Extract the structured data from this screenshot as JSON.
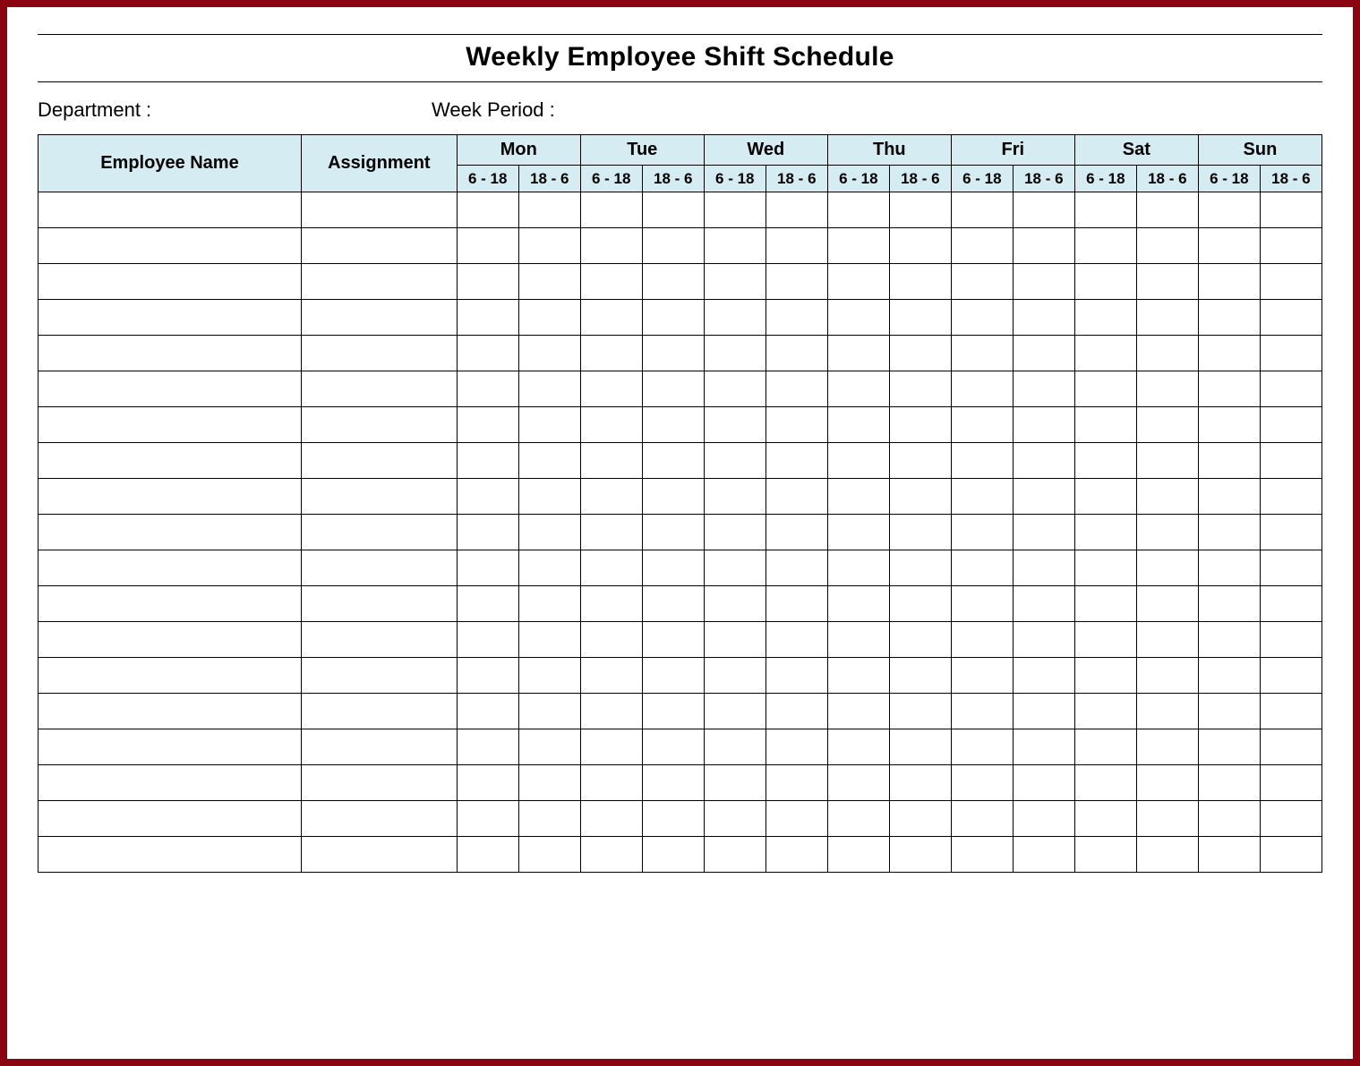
{
  "title": "Weekly Employee Shift Schedule",
  "meta": {
    "department_label": "Department :",
    "week_period_label": "Week  Period :"
  },
  "headers": {
    "employee": "Employee Name",
    "assignment": "Assignment",
    "days": [
      "Mon",
      "Tue",
      "Wed",
      "Thu",
      "Fri",
      "Sat",
      "Sun"
    ],
    "shifts": [
      "6 - 18",
      "18 - 6"
    ]
  },
  "row_count": 19,
  "colors": {
    "frame": "#8a0412",
    "header_bg": "#d6ecf3"
  }
}
